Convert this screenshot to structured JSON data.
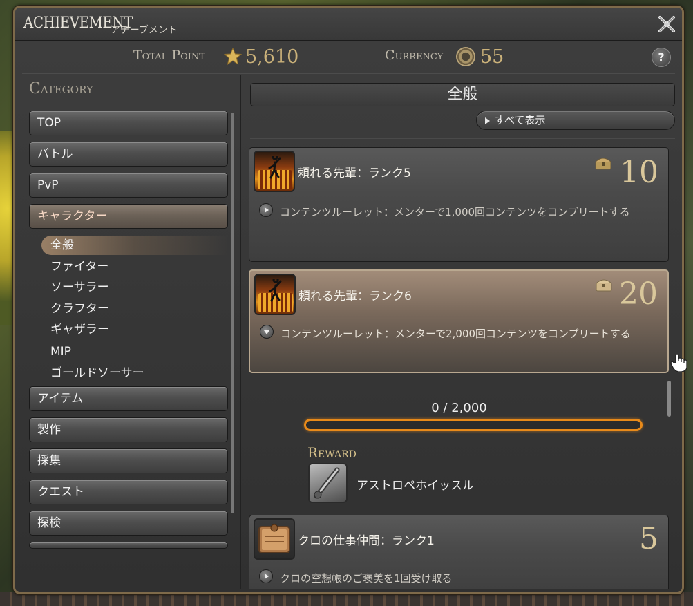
{
  "window": {
    "title_en": "ACHIEVEMENT",
    "title_jp": "アチーブメント",
    "total_point_label": "Total Point",
    "total_point_value": "5,610",
    "currency_label": "Currency",
    "currency_value": "55",
    "help_label": "?"
  },
  "left": {
    "heading": "Category",
    "categories_top": [
      {
        "label": "TOP"
      },
      {
        "label": "バトル"
      },
      {
        "label": "PvP"
      },
      {
        "label": "キャラクター"
      }
    ],
    "subcategories": [
      {
        "label": "全般"
      },
      {
        "label": "ファイター"
      },
      {
        "label": "ソーサラー"
      },
      {
        "label": "クラフター"
      },
      {
        "label": "ギャザラー"
      },
      {
        "label": "MIP"
      },
      {
        "label": "ゴールドソーサー"
      }
    ],
    "categories_bottom": [
      {
        "label": "アイテム"
      },
      {
        "label": "製作"
      },
      {
        "label": "採集"
      },
      {
        "label": "クエスト"
      },
      {
        "label": "探検"
      }
    ]
  },
  "right": {
    "section_title": "全般",
    "show_all_label": "すべて表示",
    "achievements": [
      {
        "name": "頼れる先輩：ランク5",
        "description": "コンテンツルーレット：メンターで1,000回コンテンツをコンプリートする",
        "points": "10",
        "has_reward_chest": true,
        "icon": "mentor-achievement-icon"
      },
      {
        "name": "頼れる先輩：ランク6",
        "description": "コンテンツルーレット：メンターで2,000回コンテンツをコンプリートする",
        "points": "20",
        "has_reward_chest": true,
        "icon": "mentor-achievement-icon",
        "expanded": true
      },
      {
        "name": "クロの仕事仲間：ランク1",
        "description": "クロの空想帳のご褒美を1回受け取る",
        "points": "5",
        "has_reward_chest": false,
        "icon": "book-achievement-icon"
      }
    ],
    "progress": {
      "text": "0 / 2,000",
      "fraction": 0
    },
    "reward": {
      "label": "Reward",
      "item_name": "アストロペホイッスル",
      "icon": "whistle-item-icon"
    }
  },
  "colors": {
    "frame": "#7e6a4a",
    "gold_text": "#d9c79b",
    "progress_border": "#e88a1a",
    "selected_category": "#6c6258"
  }
}
